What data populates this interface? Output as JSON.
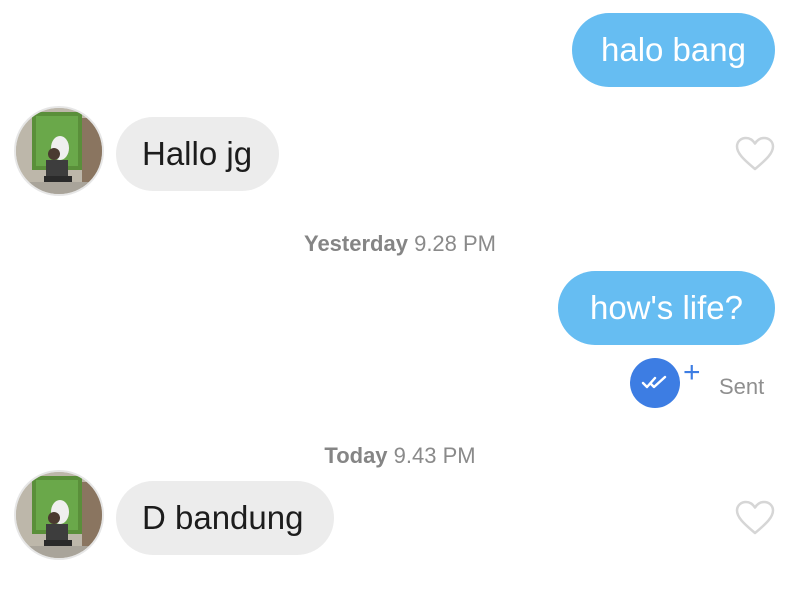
{
  "messages": [
    {
      "direction": "outgoing",
      "text": "halo bang"
    },
    {
      "direction": "incoming",
      "text": "Hallo jg",
      "avatar": "contact-avatar",
      "reaction_icon": "heart-outline-icon"
    },
    {
      "direction": "outgoing",
      "text": "how's life?"
    },
    {
      "direction": "incoming",
      "text": "D bandung",
      "avatar": "contact-avatar",
      "reaction_icon": "heart-outline-icon"
    }
  ],
  "timestamps": [
    {
      "day": "Yesterday",
      "time": "9.28 PM"
    },
    {
      "day": "Today",
      "time": "9.43 PM"
    }
  ],
  "status": {
    "badge_icon": "double-check-icon",
    "plus_symbol": "+",
    "label": "Sent"
  },
  "colors": {
    "outgoing_bubble": "#66bdf2",
    "incoming_bubble": "#ececec",
    "read_badge": "#3d7de3",
    "timestamp_text": "#8a8a8a"
  }
}
